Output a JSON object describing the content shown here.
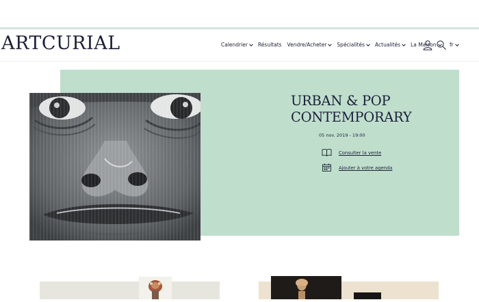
{
  "brand": {
    "logo_text": "ARTCURIAL"
  },
  "nav": {
    "items": [
      {
        "label": "Calendrier",
        "has_dropdown": true
      },
      {
        "label": "Résultats",
        "has_dropdown": false
      },
      {
        "label": "Vendre/Acheter",
        "has_dropdown": true
      },
      {
        "label": "Spécialités",
        "has_dropdown": true
      },
      {
        "label": "Actualités",
        "has_dropdown": true
      },
      {
        "label": "La Maison",
        "has_dropdown": true
      }
    ],
    "account_icon": "user-icon",
    "search_icon": "search-icon",
    "language": "fr"
  },
  "hero": {
    "title_line1": "URBAN & POP",
    "title_line2": "CONTEMPORARY",
    "date": "05 nov. 2019 - 19:00",
    "actions": [
      {
        "icon": "book-icon",
        "label": "Consulter la vente"
      },
      {
        "icon": "calendar-icon",
        "label": "Ajouter à votre agenda"
      }
    ],
    "background_color": "#bfdfcc"
  },
  "colors": {
    "text": "#1b1f3a",
    "accent_band": "#d7e3dc"
  }
}
